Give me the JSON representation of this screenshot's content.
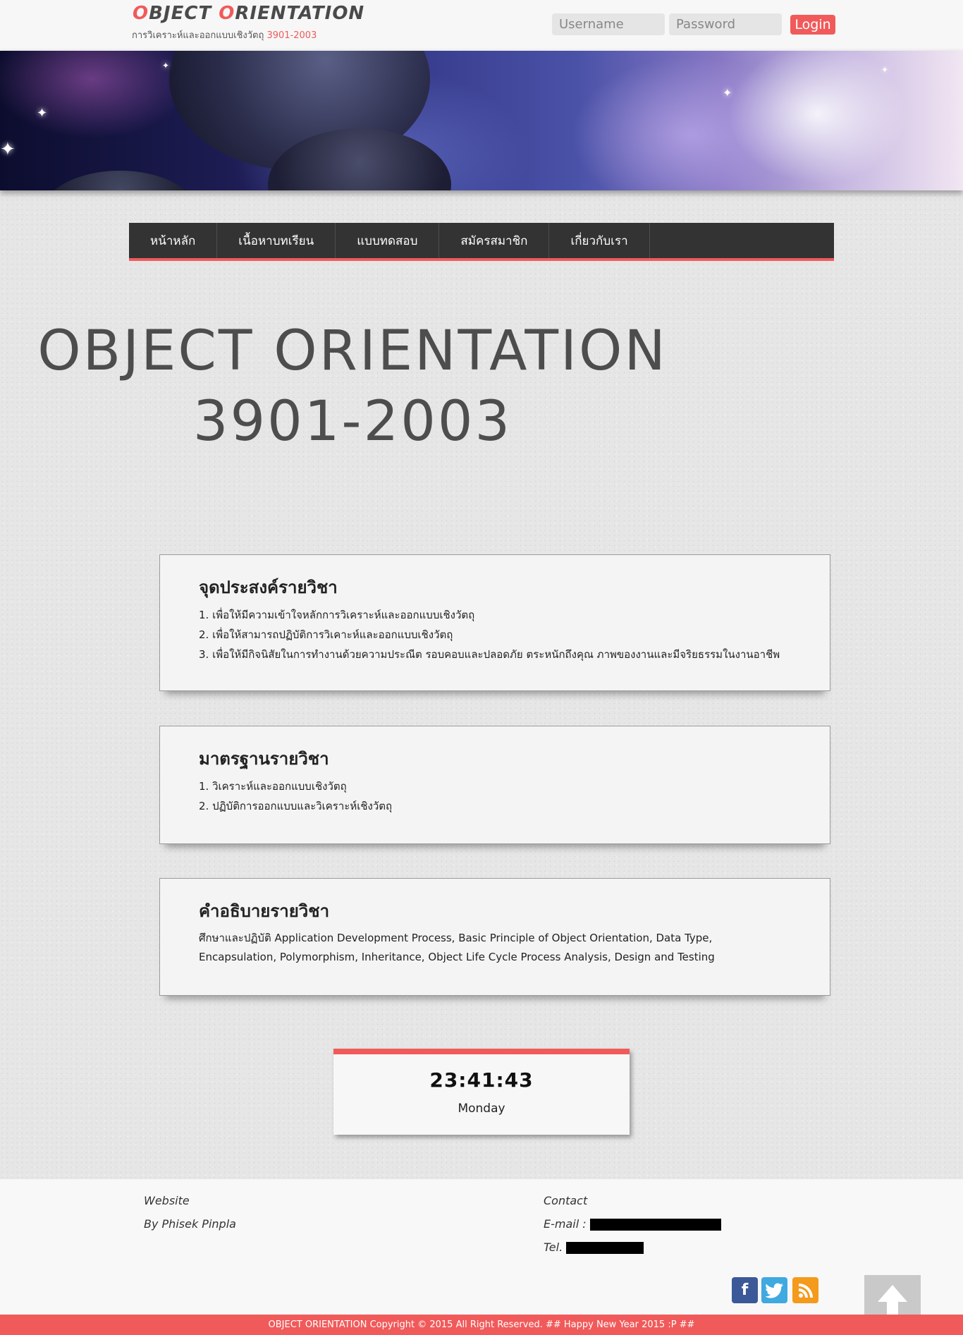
{
  "header": {
    "logo_first": "O",
    "logo_word1_rest": "BJECT ",
    "logo_second": "O",
    "logo_word2_rest": "RIENTATION",
    "subtitle_text": "การวิเคราะห์และออกแบบเชิงวัตถุ ",
    "subtitle_code": "3901-2003",
    "username_placeholder": "Username",
    "password_placeholder": "Password",
    "login_label": "Login"
  },
  "nav": {
    "items": [
      {
        "label": "หน้าหลัก"
      },
      {
        "label": "เนื้อหาบทเรียน"
      },
      {
        "label": "แบบทดสอบ"
      },
      {
        "label": "สมัครสมาชิก"
      },
      {
        "label": "เกี่ยวกับเรา"
      }
    ]
  },
  "hero": {
    "line1": "OBJECT ORIENTATION",
    "line2": "3901-2003"
  },
  "sections": {
    "objectives": {
      "title": "จุดประสงค์รายวิชา",
      "items": [
        "1. เพื่อให้มีความเข้าใจหลักการวิเคราะห์และออกแบบเชิงวัตถุ",
        "2. เพื่อให้สามารถปฏิบัติการวิเคาะห์และออกแบบเชิงวัตถุ",
        "3. เพื่อให้มีกิจนิสัยในการทำงานด้วยความประณีต รอบคอบและปลอดภัย ตระหนักถึงคุณ ภาพของงานและมีจริยธรรมในงานอาชีพ"
      ]
    },
    "standards": {
      "title": "มาตรฐานรายวิชา",
      "items": [
        "1. วิเคราะห์และออกแบบเชิงวัตถุ",
        "2. ปฏิบัติการออกแบบและวิเคราะห์เชิงวัตถุ"
      ]
    },
    "description": {
      "title": "คำอธิบายรายวิชา",
      "text": "ศึกษาและปฏิบัติ Application Development Process, Basic Principle of Object Orientation, Data Type, Encapsulation, Polymorphism, Inheritance, Object Life Cycle Process Analysis, Design and Testing"
    }
  },
  "clock": {
    "time": "23:41:43",
    "day": "Monday"
  },
  "footer": {
    "website_heading": "Website",
    "author": "By Phisek Pinpla",
    "contact_heading": "Contact",
    "email_label": "E-mail :",
    "tel_label": "Tel.",
    "copyright": "OBJECT ORIENTATION Copyright © 2015 All Right Reserved. ## Happy New Year 2015 :P ##",
    "social_facebook": "f",
    "social_twitter": "t",
    "social_rss": "rss"
  },
  "colors": {
    "accent": "#f15a5a",
    "nav_bg": "#333333",
    "facebook": "#3b5998",
    "twitter": "#3fa9e0",
    "rss": "#f49a1c"
  }
}
